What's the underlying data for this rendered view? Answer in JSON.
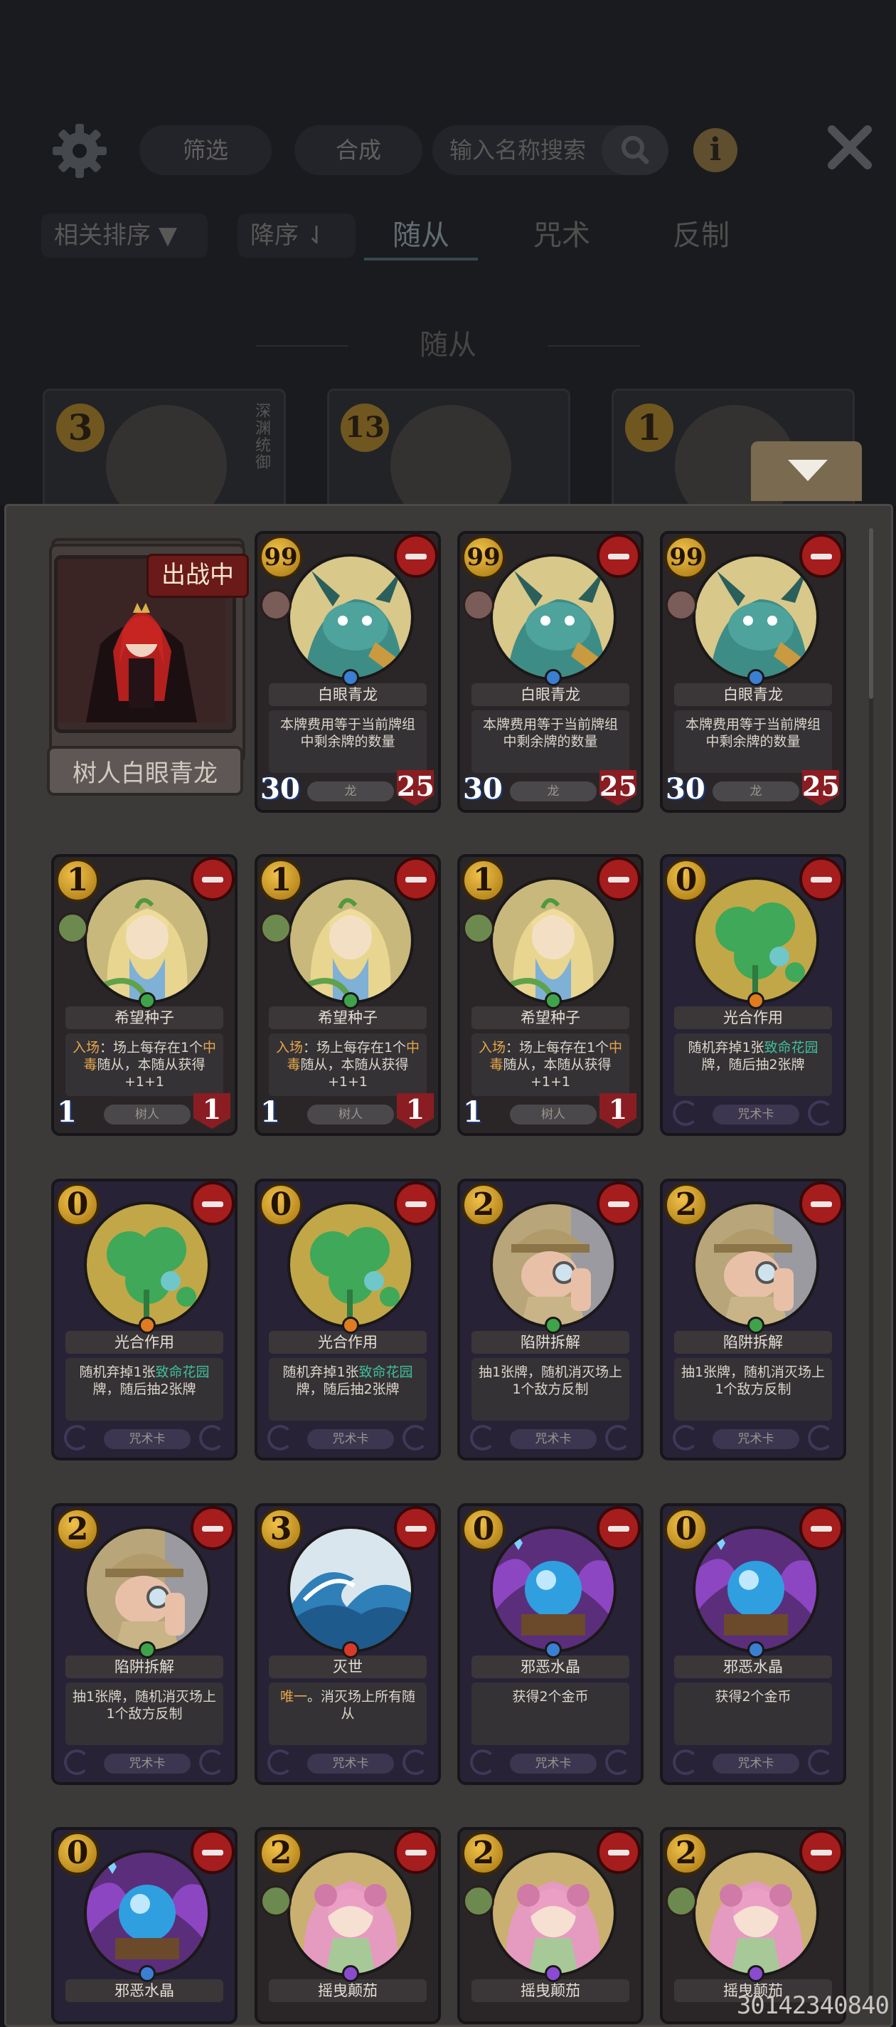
{
  "toolbar": {
    "filter_label": "筛选",
    "craft_label": "合成",
    "search_placeholder": "输入名称搜索",
    "info_label": "i"
  },
  "sort": {
    "relevance_label": "相关排序",
    "order_label": "降序"
  },
  "tabs": [
    {
      "label": "随从",
      "active": true
    },
    {
      "label": "咒术",
      "active": false
    },
    {
      "label": "反制",
      "active": false
    }
  ],
  "section_title": "随从",
  "background_cards": [
    {
      "cost": "3",
      "side_text": "深渊统御"
    },
    {
      "cost": "13",
      "side_text": ""
    },
    {
      "cost": "1",
      "side_text": ""
    }
  ],
  "hero": {
    "status_badge": "出战中",
    "name": "树人白眼青龙"
  },
  "cards": [
    {
      "cost": "99",
      "name": "白眼青龙",
      "desc": "本牌费用等于当前牌组中剩余牌的数量",
      "attack": "30",
      "health": "25",
      "type": "龙",
      "kind": "minion",
      "gem": "#3a7fd1",
      "art": "dragon",
      "tribe": "beast"
    },
    {
      "cost": "99",
      "name": "白眼青龙",
      "desc": "本牌费用等于当前牌组中剩余牌的数量",
      "attack": "30",
      "health": "25",
      "type": "龙",
      "kind": "minion",
      "gem": "#3a7fd1",
      "art": "dragon",
      "tribe": "beast"
    },
    {
      "cost": "99",
      "name": "白眼青龙",
      "desc": "本牌费用等于当前牌组中剩余牌的数量",
      "attack": "30",
      "health": "25",
      "type": "龙",
      "kind": "minion",
      "gem": "#3a7fd1",
      "art": "dragon",
      "tribe": "beast"
    },
    {
      "cost": "1",
      "name": "希望种子",
      "desc_parts": [
        "入场",
        "：场上每存在1个",
        "中毒",
        "随从，本随从获得+1+1"
      ],
      "attack": "1",
      "health": "1",
      "type": "树人",
      "kind": "minion",
      "gem": "#3fa34a",
      "art": "seed",
      "tribe": "plant"
    },
    {
      "cost": "1",
      "name": "希望种子",
      "desc_parts": [
        "入场",
        "：场上每存在1个",
        "中毒",
        "随从，本随从获得+1+1"
      ],
      "attack": "1",
      "health": "1",
      "type": "树人",
      "kind": "minion",
      "gem": "#3fa34a",
      "art": "seed",
      "tribe": "plant"
    },
    {
      "cost": "1",
      "name": "希望种子",
      "desc_parts": [
        "入场",
        "：场上每存在1个",
        "中毒",
        "随从，本随从获得+1+1"
      ],
      "attack": "1",
      "health": "1",
      "type": "树人",
      "kind": "minion",
      "gem": "#3fa34a",
      "art": "seed",
      "tribe": "plant"
    },
    {
      "cost": "0",
      "name": "光合作用",
      "desc_parts": [
        "随机弃掉1张",
        "致命花园",
        "牌，随后抽2张牌"
      ],
      "type": "咒术卡",
      "kind": "spell",
      "gem": "#e07b1f",
      "art": "clover"
    },
    {
      "cost": "0",
      "name": "光合作用",
      "desc_parts": [
        "随机弃掉1张",
        "致命花园",
        "牌，随后抽2张牌"
      ],
      "type": "咒术卡",
      "kind": "spell",
      "gem": "#e07b1f",
      "art": "clover"
    },
    {
      "cost": "0",
      "name": "光合作用",
      "desc_parts": [
        "随机弃掉1张",
        "致命花园",
        "牌，随后抽2张牌"
      ],
      "type": "咒术卡",
      "kind": "spell",
      "gem": "#e07b1f",
      "art": "clover"
    },
    {
      "cost": "2",
      "name": "陷阱拆解",
      "desc": "抽1张牌，随机消灭场上1个敌方反制",
      "type": "咒术卡",
      "kind": "spell",
      "gem": "#3fa34a",
      "art": "detective"
    },
    {
      "cost": "2",
      "name": "陷阱拆解",
      "desc": "抽1张牌，随机消灭场上1个敌方反制",
      "type": "咒术卡",
      "kind": "spell",
      "gem": "#3fa34a",
      "art": "detective"
    },
    {
      "cost": "2",
      "name": "陷阱拆解",
      "desc": "抽1张牌，随机消灭场上1个敌方反制",
      "type": "咒术卡",
      "kind": "spell",
      "gem": "#3fa34a",
      "art": "detective"
    },
    {
      "cost": "3",
      "name": "灭世",
      "desc_parts": [
        "唯一",
        "。消灭场上所有随从"
      ],
      "type": "咒术卡",
      "kind": "spell",
      "gem": "#d83a2a",
      "art": "wave"
    },
    {
      "cost": "0",
      "name": "邪恶水晶",
      "desc": "获得2个金币",
      "type": "咒术卡",
      "kind": "spell",
      "gem": "#3a7fd1",
      "art": "crystal"
    },
    {
      "cost": "0",
      "name": "邪恶水晶",
      "desc": "获得2个金币",
      "type": "咒术卡",
      "kind": "spell",
      "gem": "#3a7fd1",
      "art": "crystal"
    },
    {
      "cost": "0",
      "name": "邪恶水晶",
      "desc": "",
      "type": "",
      "kind": "spell",
      "gem": "#3a7fd1",
      "art": "crystal"
    },
    {
      "cost": "2",
      "name": "摇曳颠茄",
      "desc": "",
      "type": "",
      "kind": "minion",
      "gem": "#8a4bd1",
      "art": "girl",
      "tribe": "plant"
    },
    {
      "cost": "2",
      "name": "摇曳颠茄",
      "desc": "",
      "type": "",
      "kind": "minion",
      "gem": "#8a4bd1",
      "art": "girl",
      "tribe": "plant"
    },
    {
      "cost": "2",
      "name": "摇曳颠茄",
      "desc": "",
      "type": "",
      "kind": "minion",
      "gem": "#8a4bd1",
      "art": "girl",
      "tribe": "plant"
    }
  ],
  "watermark": "30142340840"
}
